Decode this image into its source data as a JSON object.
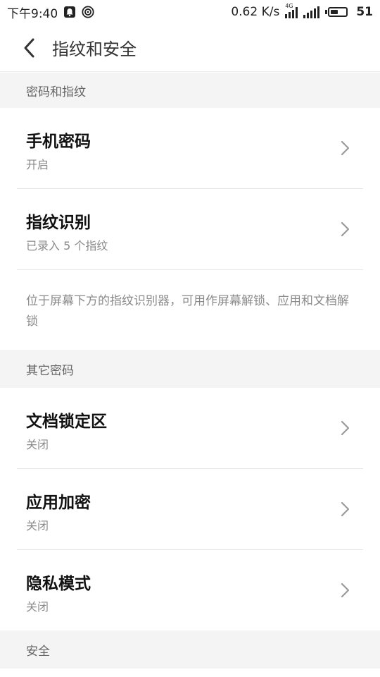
{
  "status_bar": {
    "time": "下午9:40",
    "net_speed": "0.62 K/s",
    "network_type": "4G",
    "battery_percent": "51",
    "battery_level": 0.51
  },
  "toolbar": {
    "title": "指纹和安全",
    "back_icon": "chevron-left-icon"
  },
  "sections": {
    "password_fingerprint": {
      "header": "密码和指纹",
      "items": [
        {
          "title": "手机密码",
          "subtitle": "开启"
        },
        {
          "title": "指纹识别",
          "subtitle": "已录入 5 个指纹"
        }
      ],
      "description": "位于屏幕下方的指纹识别器，可用作屏幕解锁、应用和文档解锁"
    },
    "other_passwords": {
      "header": "其它密码",
      "items": [
        {
          "title": "文档锁定区",
          "subtitle": "关闭"
        },
        {
          "title": "应用加密",
          "subtitle": "关闭"
        },
        {
          "title": "隐私模式",
          "subtitle": "关闭"
        }
      ]
    },
    "security": {
      "header": "安全"
    }
  },
  "colors": {
    "section_bg": "#f4f4f4",
    "divider": "#e6e6e6",
    "secondary_text": "#8a8a8a"
  }
}
